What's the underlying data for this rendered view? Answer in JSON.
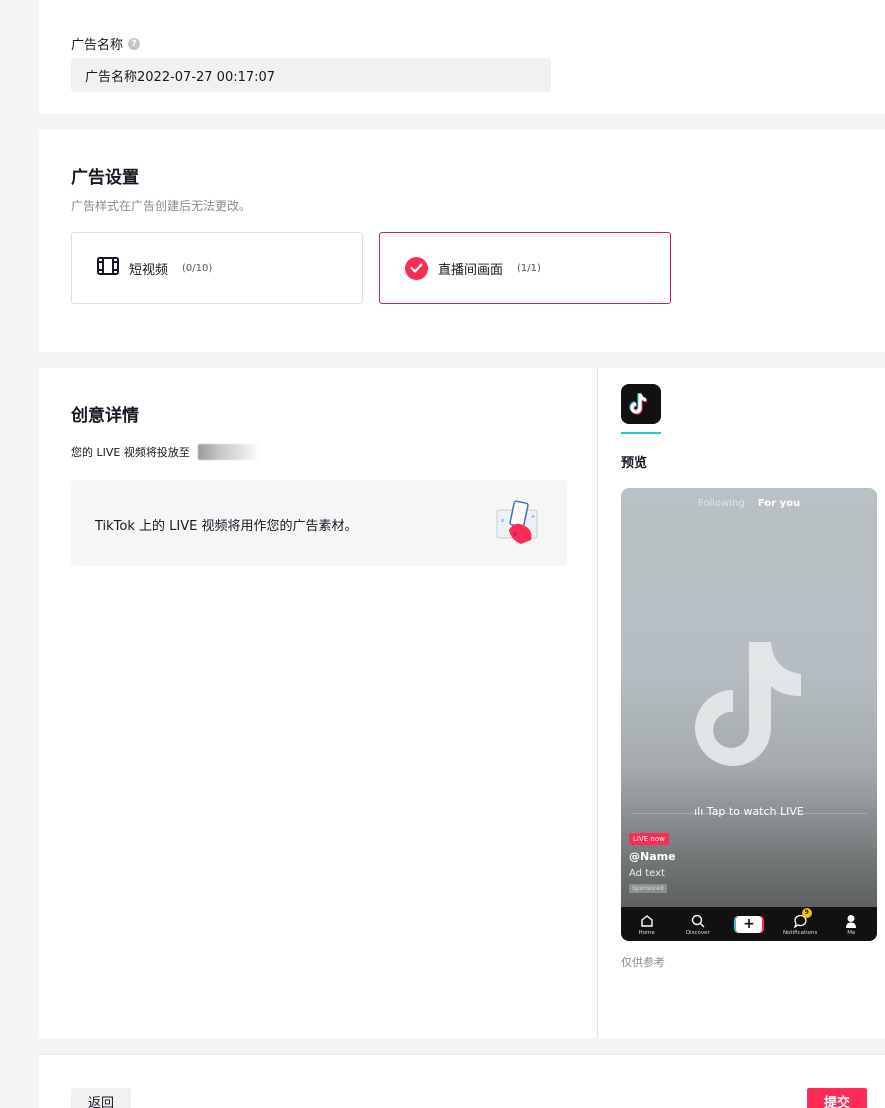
{
  "ad_name": {
    "label": "广告名称",
    "value": "广告名称2022-07-27 00:17:07",
    "help_icon": "question-circle-icon"
  },
  "ad_settings": {
    "title": "广告设置",
    "subtitle": "广告样式在广告创建后无法更改。",
    "options": [
      {
        "label": "短视频",
        "count": "(0/10)",
        "icon": "film-icon",
        "selected": false
      },
      {
        "label": "直播间画面",
        "count": "(1/1)",
        "icon": "check-circle-icon",
        "selected": true
      }
    ],
    "accent_color": "#fe2c55"
  },
  "creative": {
    "title": "创意详情",
    "delivery_prefix": "您的 LIVE 视频将投放至",
    "info_text": "TikTok 上的 LIVE 视频将用作您的广告素材。"
  },
  "preview": {
    "label": "预览",
    "tab_following": "Following",
    "tab_for_you": "For you",
    "tap_to_watch": "ılı Tap to watch LIVE",
    "live_badge": "LIVE now",
    "username": "@Name",
    "ad_text": "Ad text",
    "sponsored": "Sponsored",
    "nav": {
      "home": "Home",
      "discover": "Discover",
      "notifications": "Notifications",
      "me": "Me",
      "notif_count": "9"
    },
    "note": "仅供参考"
  },
  "footer": {
    "back_label": "返回",
    "submit_label": "提交"
  }
}
